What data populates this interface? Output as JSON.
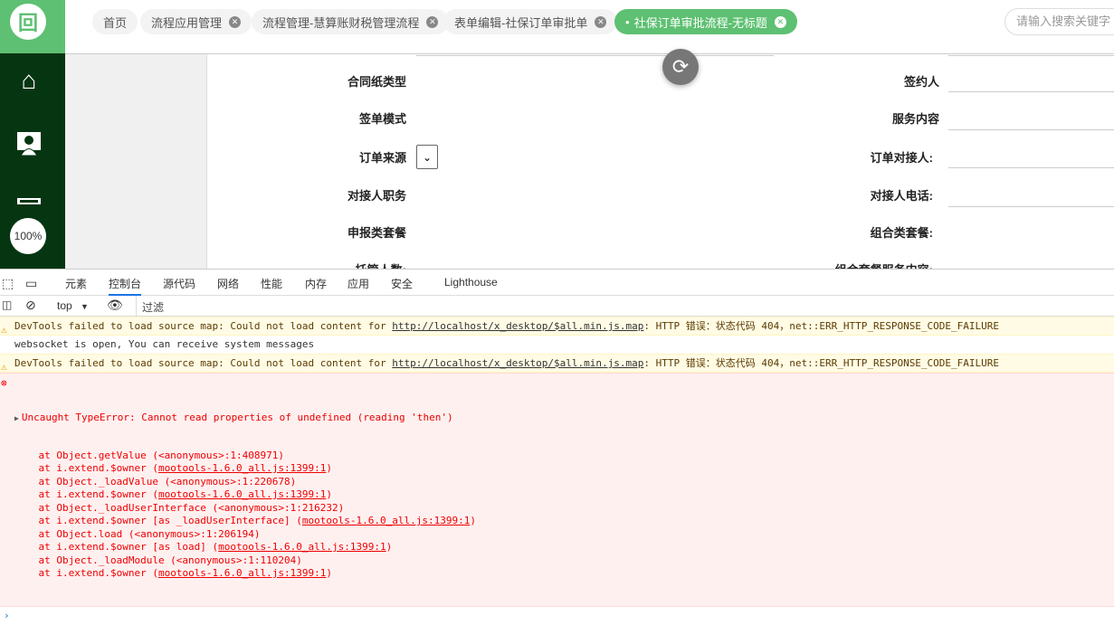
{
  "header": {
    "tabs": [
      {
        "label": "首页",
        "closable": false
      },
      {
        "label": "流程应用管理",
        "closable": true
      },
      {
        "label": "流程管理-慧算账财税管理流程",
        "closable": true
      },
      {
        "label": "表单编辑-社保订单审批单",
        "closable": true
      },
      {
        "label": "社保订单审批流程-无标题",
        "closable": true,
        "active": true
      }
    ],
    "search_placeholder": "请输入搜索关键字"
  },
  "sidebar": {
    "zoom": "100%"
  },
  "form": {
    "left_labels": [
      "合同纸类型",
      "签单模式",
      "订单来源",
      "对接人职务",
      "申报类套餐",
      "托管人数:"
    ],
    "right_labels": [
      "签约人",
      "服务内容",
      "订单对接人:",
      "对接人电话:",
      "组合类套餐:",
      "组合套餐服务内容:"
    ]
  },
  "devtools": {
    "tabs": [
      "元素",
      "控制台",
      "源代码",
      "网络",
      "性能",
      "内存",
      "应用",
      "安全",
      "Lighthouse"
    ],
    "active_tab": "控制台",
    "context": "top",
    "filter_placeholder": "过滤",
    "messages": [
      {
        "type": "warning",
        "pre": "DevTools failed to load source map: Could not load content for ",
        "link": "http://localhost/x_desktop/$all.min.js.map",
        "post": ": HTTP 错误：状态代码 404，net::ERR_HTTP_RESPONSE_CODE_FAILURE"
      },
      {
        "type": "log",
        "text": "websocket is open, You can receive system messages"
      },
      {
        "type": "warning",
        "pre": "DevTools failed to load source map: Could not load content for ",
        "link": "http://localhost/x_desktop/$all.min.js.map",
        "post": ": HTTP 错误：状态代码 404，net::ERR_HTTP_RESPONSE_CODE_FAILURE"
      }
    ],
    "error": {
      "title": "Uncaught TypeError: Cannot read properties of undefined (reading 'then')",
      "stack": [
        {
          "pre": "    at Object.getValue (<anonymous>:1:408971)",
          "link": ""
        },
        {
          "pre": "    at i.extend.$owner (",
          "link": "mootools-1.6.0_all.js:1399:1",
          "post": ")"
        },
        {
          "pre": "    at Object._loadValue (<anonymous>:1:220678)",
          "link": ""
        },
        {
          "pre": "    at i.extend.$owner (",
          "link": "mootools-1.6.0_all.js:1399:1",
          "post": ")"
        },
        {
          "pre": "    at Object._loadUserInterface (<anonymous>:1:216232)",
          "link": ""
        },
        {
          "pre": "    at i.extend.$owner [as _loadUserInterface] (",
          "link": "mootools-1.6.0_all.js:1399:1",
          "post": ")"
        },
        {
          "pre": "    at Object.load (<anonymous>:1:206194)",
          "link": ""
        },
        {
          "pre": "    at i.extend.$owner [as load] (",
          "link": "mootools-1.6.0_all.js:1399:1",
          "post": ")"
        },
        {
          "pre": "    at Object._loadModule (<anonymous>:1:110204)",
          "link": ""
        },
        {
          "pre": "    at i.extend.$owner (",
          "link": "mootools-1.6.0_all.js:1399:1",
          "post": ")"
        }
      ]
    }
  }
}
